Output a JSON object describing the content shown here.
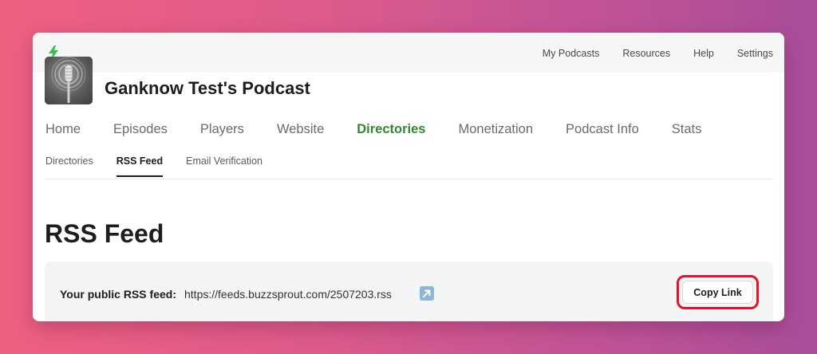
{
  "top_nav": [
    "My Podcasts",
    "Resources",
    "Help",
    "Settings"
  ],
  "podcast": {
    "title": "Ganknow Test's Podcast"
  },
  "main_nav": [
    {
      "label": "Home",
      "active": false
    },
    {
      "label": "Episodes",
      "active": false
    },
    {
      "label": "Players",
      "active": false
    },
    {
      "label": "Website",
      "active": false
    },
    {
      "label": "Directories",
      "active": true
    },
    {
      "label": "Monetization",
      "active": false
    },
    {
      "label": "Podcast Info",
      "active": false
    },
    {
      "label": "Stats",
      "active": false
    }
  ],
  "sub_nav": [
    {
      "label": "Directories",
      "active": false
    },
    {
      "label": "RSS Feed",
      "active": true
    },
    {
      "label": "Email Verification",
      "active": false
    }
  ],
  "page": {
    "title": "RSS Feed"
  },
  "feed": {
    "label": "Your public RSS feed:",
    "url": "https://feeds.buzzsprout.com/2507203.rss",
    "open_icon": "external-link-icon",
    "copy_label": "Copy Link"
  },
  "colors": {
    "active_nav": "#2f8a2f",
    "highlight_border": "#e3112a",
    "brand_bolt": "#3cbf4a"
  },
  "icons": {
    "brand": "lightning-bolt-icon",
    "cover": "microphone-icon"
  }
}
